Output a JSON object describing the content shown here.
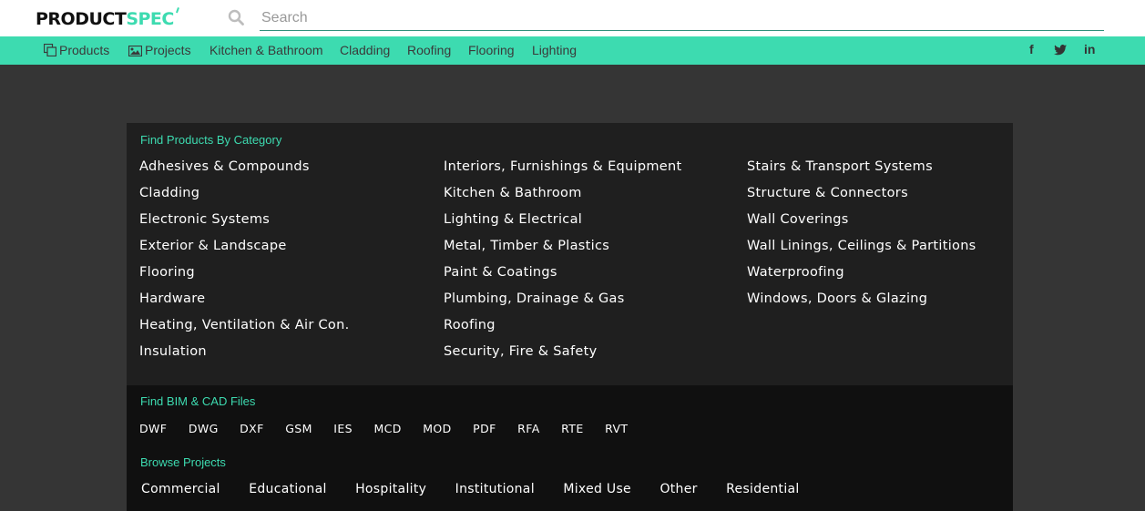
{
  "header": {
    "logo_primary": "PRODUCT",
    "logo_accent": "SPEC",
    "search_placeholder": "Search",
    "search_value": ""
  },
  "nav": {
    "items": [
      {
        "label": "Products",
        "icon": "copy-icon"
      },
      {
        "label": "Projects",
        "icon": "image-icon"
      },
      {
        "label": "Kitchen & Bathroom"
      },
      {
        "label": "Cladding"
      },
      {
        "label": "Roofing"
      },
      {
        "label": "Flooring"
      },
      {
        "label": "Lighting"
      }
    ],
    "social": [
      "f",
      "t",
      "in"
    ]
  },
  "categories": {
    "title": "Find Products By Category",
    "col1": [
      "Adhesives & Compounds",
      "Cladding",
      "Electronic Systems",
      "Exterior & Landscape",
      "Flooring",
      "Hardware",
      "Heating, Ventilation & Air Con.",
      "Insulation"
    ],
    "col2": [
      "Interiors, Furnishings & Equipment",
      "Kitchen & Bathroom",
      "Lighting & Electrical",
      "Metal, Timber & Plastics",
      "Paint & Coatings",
      "Plumbing, Drainage & Gas",
      "Roofing",
      "Security, Fire & Safety"
    ],
    "col3": [
      "Stairs & Transport Systems",
      "Structure & Connectors",
      "Wall Coverings",
      "Wall Linings, Ceilings & Partitions",
      "Waterproofing",
      "Windows, Doors & Glazing"
    ]
  },
  "files": {
    "title": "Find BIM & CAD Files",
    "items": [
      "DWF",
      "DWG",
      "DXF",
      "GSM",
      "IES",
      "MCD",
      "MOD",
      "PDF",
      "RFA",
      "RTE",
      "RVT"
    ]
  },
  "projects": {
    "title": "Browse Projects",
    "items": [
      "Commercial",
      "Educational",
      "Hospitality",
      "Institutional",
      "Mixed Use",
      "Other",
      "Residential"
    ]
  },
  "colors": {
    "accent": "#3ddbb0",
    "page_bg": "#353535",
    "panel_bg": "#1f1f1f",
    "panel_dark_bg": "#101010"
  }
}
